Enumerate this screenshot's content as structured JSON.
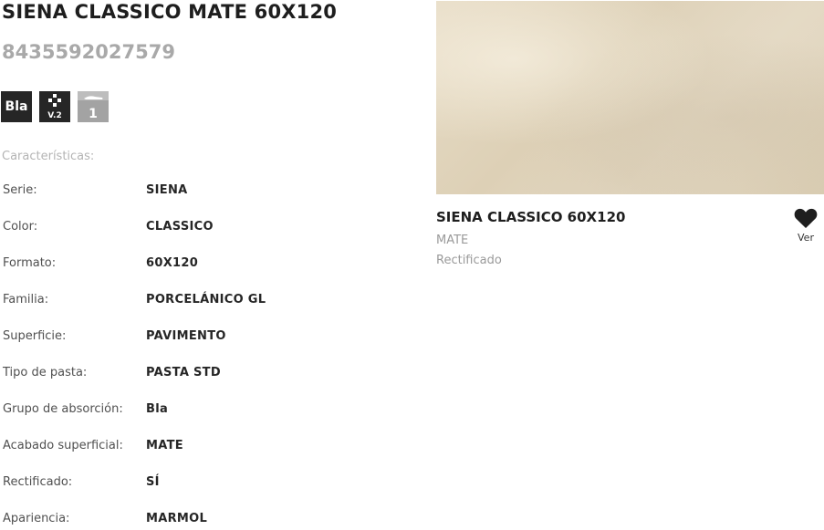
{
  "product": {
    "title": "SIENA CLASSICO MATE 60X120",
    "ean": "8435592027579"
  },
  "badges": {
    "absorption": "Bla",
    "variation": "V.2",
    "rating": "1"
  },
  "specs": {
    "heading": "Características:",
    "rows": [
      {
        "label": "Serie:",
        "value": "SIENA"
      },
      {
        "label": "Color:",
        "value": "CLASSICO"
      },
      {
        "label": "Formato:",
        "value": "60X120"
      },
      {
        "label": "Familia:",
        "value": "PORCELÁNICO GL"
      },
      {
        "label": "Superficie:",
        "value": "PAVIMENTO"
      },
      {
        "label": "Tipo de pasta:",
        "value": "PASTA STD"
      },
      {
        "label": "Grupo de absorción:",
        "value": "Bla"
      },
      {
        "label": "Acabado superficial:",
        "value": "MATE"
      },
      {
        "label": "Rectificado:",
        "value": "SÍ"
      },
      {
        "label": "Apariencia:",
        "value": "MARMOL"
      }
    ]
  },
  "card": {
    "title": "SIENA CLASSICO 60X120",
    "finish": "MATE",
    "edge": "Rectificado",
    "fav_label": "Ver"
  },
  "icons": {
    "heart": "heart-icon",
    "pattern": "pattern-variation-icon",
    "slip": "slip-resistance-icon"
  }
}
